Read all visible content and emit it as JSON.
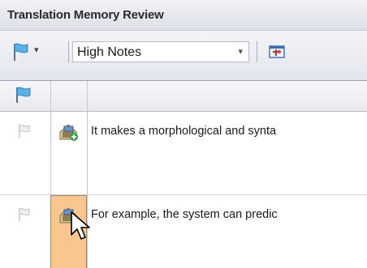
{
  "window": {
    "title": "Translation Memory Review"
  },
  "toolbar": {
    "flag_icon": "flag-filter-icon",
    "dropdown_arrow": "▾",
    "filter_select": {
      "value": "High Notes",
      "arrow": "▾"
    },
    "pin_icon": "pin-window-icon"
  },
  "grid": {
    "header_flag_icon": "flag-header-icon",
    "rows": [
      {
        "flag_icon": "flag-icon",
        "status_icon": "tm-new-segment-icon",
        "text": "It makes a morphological and synta"
      },
      {
        "flag_icon": "flag-icon",
        "status_icon": "tm-edit-segment-icon",
        "text": "For example, the system can predic",
        "selected": true
      }
    ]
  },
  "colors": {
    "selection": "#f9c690",
    "title_text": "#2b2b2b"
  }
}
